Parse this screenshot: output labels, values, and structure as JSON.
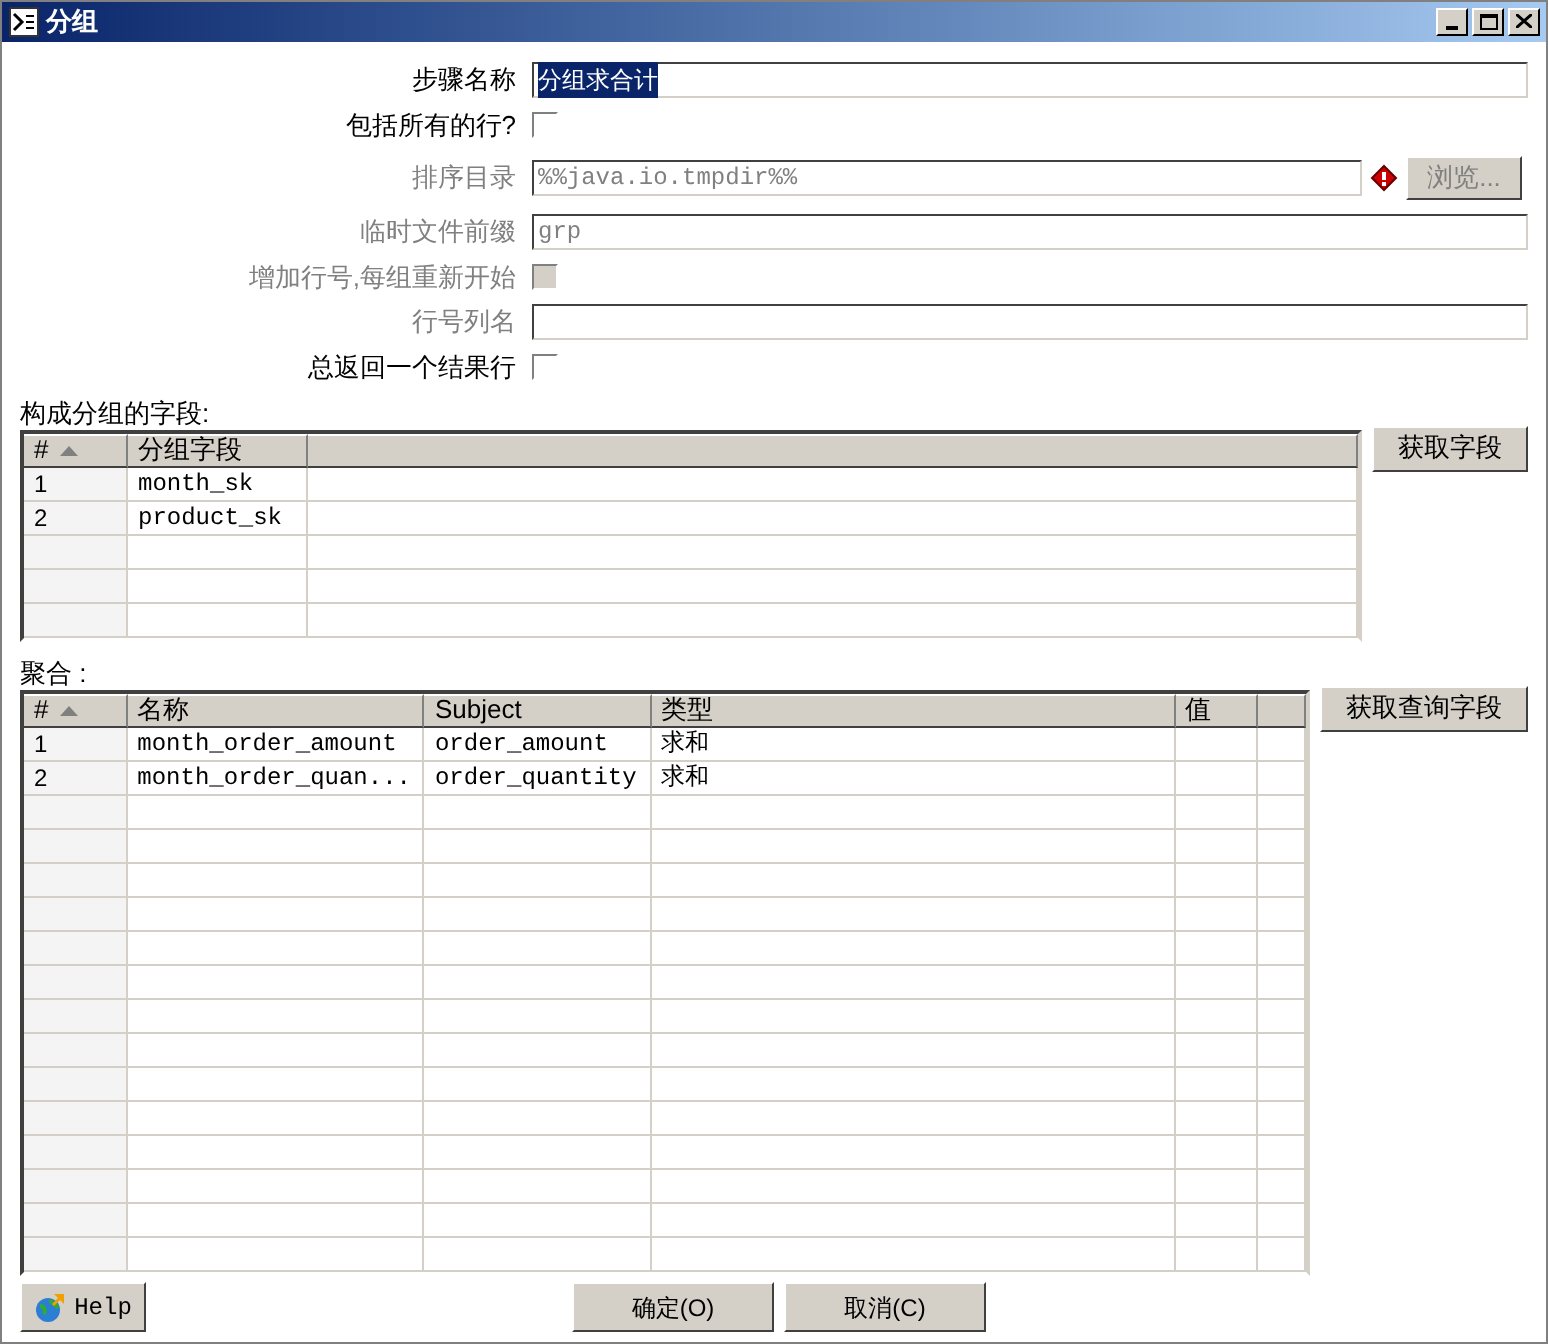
{
  "window": {
    "title": "分组"
  },
  "form": [
    {
      "kind": "text",
      "label": "步骤名称",
      "value": "分组求合计",
      "disabled": false,
      "selected": true
    },
    {
      "kind": "checkbox",
      "label": "包括所有的行?",
      "checked": false,
      "disabled": false
    },
    {
      "kind": "browse",
      "label": "排序目录",
      "value": "%%java.io.tmpdir%%",
      "disabled": true,
      "button": "浏览..."
    },
    {
      "kind": "text",
      "label": "临时文件前缀",
      "value": "grp",
      "disabled": true,
      "selected": false
    },
    {
      "kind": "checkbox",
      "label": "增加行号,每组重新开始",
      "checked": false,
      "disabled": true
    },
    {
      "kind": "text",
      "label": "行号列名",
      "disabled": true
    },
    {
      "kind": "checkbox",
      "label": "总返回一个结果行",
      "checked": false,
      "disabled": false
    }
  ],
  "group_table": {
    "label": "构成分组的字段:",
    "button": "获取字段",
    "columns": [
      {
        "label": "#",
        "sorted": true
      },
      {
        "label": "分组字段",
        "sorted": false
      },
      {
        "sorted": false
      }
    ],
    "rows": [
      [
        "1",
        "month_sk"
      ],
      [
        "2",
        "product_sk"
      ]
    ]
  },
  "aggregate_table": {
    "label": "聚合 :",
    "button": "获取查询字段",
    "columns": [
      {
        "label": "#",
        "sorted": true
      },
      {
        "label": "名称",
        "sorted": false
      },
      {
        "label": "Subject",
        "sorted": false
      },
      {
        "label": "类型",
        "sorted": false
      },
      {
        "label": "值",
        "sorted": false
      },
      {
        "sorted": false
      }
    ],
    "rows": [
      [
        "1",
        "month_order_amount",
        "order_amount",
        "求和"
      ],
      [
        "2",
        "month_order_quan...",
        "order_quantity",
        "求和"
      ]
    ]
  },
  "buttons": [
    {
      "kind": "help",
      "label": "Help"
    },
    {
      "kind": "ok",
      "label": "确定(O)"
    },
    {
      "kind": "cancel",
      "label": "取消(C)"
    }
  ]
}
